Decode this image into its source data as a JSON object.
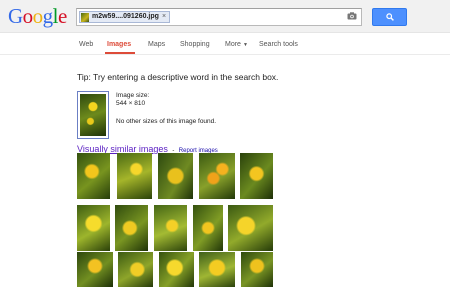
{
  "header": {
    "logo_letters": [
      {
        "ch": "G",
        "color": "#3369e8"
      },
      {
        "ch": "o",
        "color": "#d50f25"
      },
      {
        "ch": "o",
        "color": "#eeb211"
      },
      {
        "ch": "g",
        "color": "#3369e8"
      },
      {
        "ch": "l",
        "color": "#009925"
      },
      {
        "ch": "e",
        "color": "#d50f25"
      }
    ],
    "search_chip_label": "m2w59....091260.jpg",
    "chip_close": "×",
    "search_button_icon": "search-icon",
    "camera_icon": "camera-icon"
  },
  "nav": {
    "items": [
      {
        "label": "Web",
        "active": false
      },
      {
        "label": "Images",
        "active": true
      },
      {
        "label": "Maps",
        "active": false
      },
      {
        "label": "Shopping",
        "active": false
      },
      {
        "label": "More",
        "active": false
      },
      {
        "label": "Search tools",
        "active": false
      }
    ],
    "more_arrow": "▼"
  },
  "main": {
    "tip": "Tip: Try entering a descriptive word in the search box.",
    "image_size_label": "Image size:",
    "image_size_value": "544 × 810",
    "no_other_sizes": "No other sizes of this image found.",
    "visually_similar": "Visually similar images",
    "separator": "-",
    "report_images": "Report images"
  },
  "colors": {
    "accent_red": "#dd4b39",
    "search_blue": "#4d90fe",
    "visited_link": "#5a1ec2"
  }
}
